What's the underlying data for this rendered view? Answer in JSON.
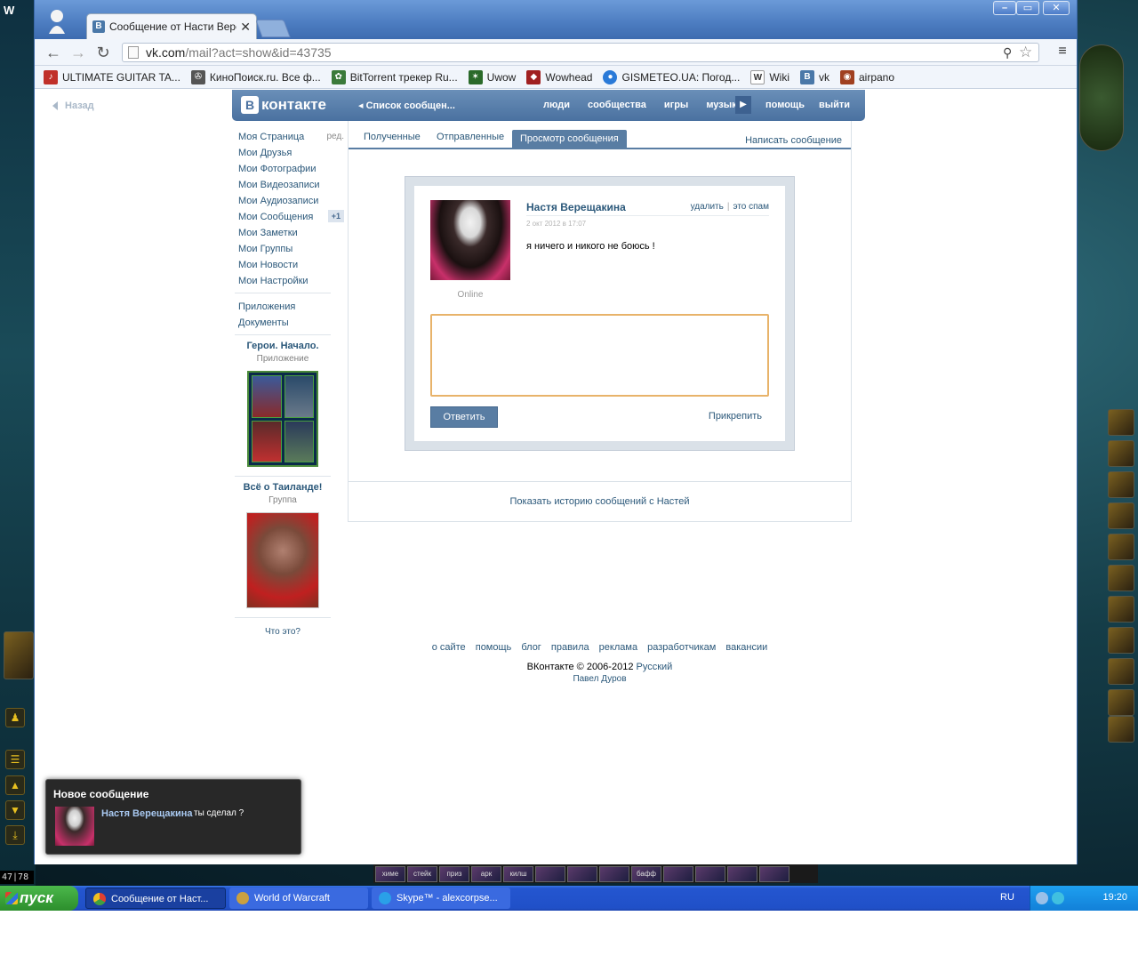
{
  "browser": {
    "tab_title": "Сообщение от Насти Вере",
    "tab_favicon": "В",
    "url_host": "vk.com",
    "url_path": "/mail?act=show&id=43735",
    "bookmarks": [
      {
        "label": "ULTIMATE GUITAR TA...",
        "icon": "guitar-icon",
        "color": "#c0302a"
      },
      {
        "label": "КиноПоиск.ru. Все ф...",
        "icon": "film-reel-icon",
        "color": "#555555"
      },
      {
        "label": "BitTorrent трекер Ru...",
        "icon": "torrent-icon",
        "color": "#3a7a3a"
      },
      {
        "label": "Uwow",
        "icon": "uwow-icon",
        "color": "#2a6a2a"
      },
      {
        "label": "Wowhead",
        "icon": "wowhead-icon",
        "color": "#a02020"
      },
      {
        "label": "GISMETEO.UA: Погод...",
        "icon": "drop-icon",
        "color": "#2a7ad8"
      },
      {
        "label": "Wiki",
        "icon": "wikipedia-icon",
        "color": "#333333"
      },
      {
        "label": "vk",
        "icon": "vk-icon",
        "color": "#4a78a8"
      },
      {
        "label": "airpano",
        "icon": "airpano-icon",
        "color": "#a04020"
      }
    ]
  },
  "vk": {
    "back": "Назад",
    "logo": "контакте",
    "logo_letter": "В",
    "crumb": "Список сообщен...",
    "nav": [
      "люди",
      "сообщества",
      "игры",
      "музыка"
    ],
    "help": "помощь",
    "logout": "выйти",
    "menu": [
      {
        "label": "Моя Страница",
        "extra": "ред."
      },
      {
        "label": "Мои Друзья"
      },
      {
        "label": "Мои Фотографии"
      },
      {
        "label": "Мои Видеозаписи"
      },
      {
        "label": "Мои Аудиозаписи"
      },
      {
        "label": "Мои Сообщения",
        "count": "+1"
      },
      {
        "label": "Мои Заметки"
      },
      {
        "label": "Мои Группы"
      },
      {
        "label": "Мои Новости"
      },
      {
        "label": "Мои Настройки"
      }
    ],
    "menu2": [
      "Приложения",
      "Документы"
    ],
    "ad1": {
      "title": "Герои. Начало.",
      "sub": "Приложение"
    },
    "ad2": {
      "title": "Всё о Таиланде!",
      "sub": "Группа"
    },
    "what_is": "Что это?",
    "tabs": {
      "inbox": "Полученные",
      "sent": "Отправленные",
      "view": "Просмотр сообщения",
      "write": "Написать сообщение"
    },
    "message": {
      "sender": "Настя Верещакина",
      "delete": "удалить",
      "spam": "это спам",
      "date": "2 окт 2012 в 17:07",
      "text": "я ничего и никого не боюсь !",
      "online": "Online",
      "reply_value": "",
      "send": "Ответить",
      "attach": "Прикрепить"
    },
    "history": "Показать историю сообщений с Настей",
    "footer_links": [
      "о сайте",
      "помощь",
      "блог",
      "правила",
      "реклама",
      "разработчикам",
      "вакансии"
    ],
    "copyright": "ВКонтакте © 2006-2012",
    "language": "Русский",
    "author": "Павел Дуров"
  },
  "notification": {
    "title": "Новое сообщение",
    "name": "Настя Верещакина",
    "text": "ты сделал ?"
  },
  "game": {
    "title_fragment": "W",
    "coords": "47|78",
    "bottom_slots": [
      "химе",
      "стейк",
      "приз",
      "арк",
      "килш",
      "",
      "",
      "",
      "бафф",
      "",
      "",
      "",
      "",
      ""
    ]
  },
  "taskbar": {
    "start": "пуск",
    "tasks": [
      {
        "label": "Сообщение от Наст...",
        "icon": "chrome-icon"
      },
      {
        "label": "World of Warcraft",
        "icon": "wow-icon"
      },
      {
        "label": "Skype™ - alexcorpse...",
        "icon": "skype-icon"
      }
    ],
    "lang": "RU",
    "time": "19:20"
  },
  "colors": {
    "vk_blue": "#597da3",
    "link": "#2b587a",
    "accent_border": "#e8b36a"
  }
}
